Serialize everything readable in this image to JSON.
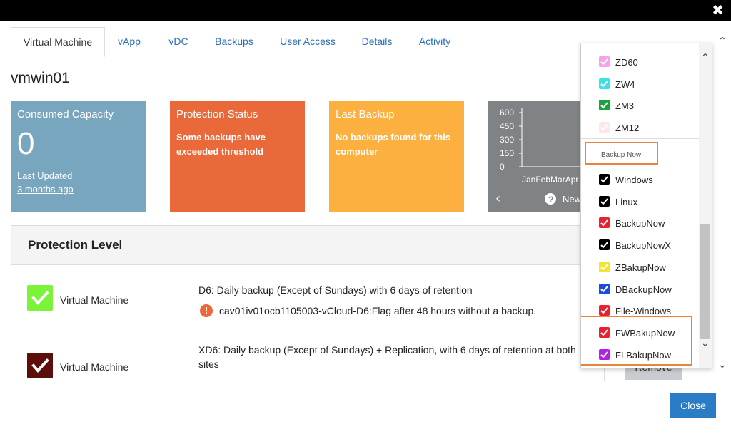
{
  "window": {
    "close_glyph": "✖"
  },
  "tabs": [
    {
      "label": "Virtual Machine",
      "active": true
    },
    {
      "label": "vApp"
    },
    {
      "label": "vDC"
    },
    {
      "label": "Backups"
    },
    {
      "label": "User Access"
    },
    {
      "label": "Details"
    },
    {
      "label": "Activity"
    }
  ],
  "vm_name": "vmwin01",
  "cards": {
    "consumed": {
      "title": "Consumed Capacity",
      "value": "0",
      "last_updated_label": "Last Updated",
      "last_updated_value": "3 months ago",
      "color": "#78a6bf"
    },
    "protection": {
      "title": "Protection Status",
      "desc": "Some backups have exceeded threshold",
      "color": "#e9693a"
    },
    "last_backup": {
      "title": "Last Backup",
      "desc": "No backups found for this computer",
      "color": "#fbb040"
    },
    "chart_card": {
      "nav_prev": "‹",
      "help_glyph": "?",
      "new_label": "New",
      "color": "#7f8386"
    }
  },
  "chart_data": {
    "type": "bar",
    "categories": [
      "Jan",
      "Feb",
      "Mar",
      "Apr"
    ],
    "values": [
      0,
      0,
      0,
      0
    ],
    "yticks": [
      "600",
      "450",
      "300",
      "150",
      "0"
    ],
    "ylim": [
      0,
      600
    ],
    "tick_text": "JanFebMarApr"
  },
  "protection": {
    "title": "Protection Level",
    "rows": [
      {
        "label": "Virtual Machine",
        "policy": "D6: Daily backup (Except of Sundays) with 6 days of retention",
        "alert": "cav01iv01ocb1105003-vCloud-D6:Flag after 48 hours without a backup.",
        "check_color": "#7cf33a"
      },
      {
        "label": "Virtual Machine",
        "policy": "XD6: Daily backup (Except of Sundays) + Replication, with 6 days of retention at both sites",
        "check_color": "#5c0f0a"
      }
    ],
    "alert_glyph": "!",
    "remove_label": "Remove"
  },
  "footer": {
    "close_label": "Close"
  },
  "dropdown": {
    "items_top": [
      {
        "label": "ZD60",
        "color": "#f5a3e8"
      },
      {
        "label": "ZW4",
        "color": "#3ee0e8"
      },
      {
        "label": "ZM3",
        "color": "#1aa33a"
      },
      {
        "label": "ZM12",
        "color": "#fde8e8"
      }
    ],
    "section_label": "Backup Now:",
    "items": [
      {
        "label": "Windows",
        "color": "#000000"
      },
      {
        "label": "Linux",
        "color": "#000000"
      },
      {
        "label": "BackupNow",
        "color": "#e8222e"
      },
      {
        "label": "BackupNowX",
        "color": "#000000"
      },
      {
        "label": "ZBakupNow",
        "color": "#f5e42c"
      },
      {
        "label": "DBackupNow",
        "color": "#1d4de0"
      },
      {
        "label": "File-Windows",
        "color": "#e8222e"
      },
      {
        "label": "FWBakupNow",
        "color": "#e8222e"
      },
      {
        "label": "FLBakupNow",
        "color": "#b21fe6"
      }
    ]
  },
  "scroll": {
    "up_glyph": "⌃",
    "down_glyph": "⌄"
  }
}
